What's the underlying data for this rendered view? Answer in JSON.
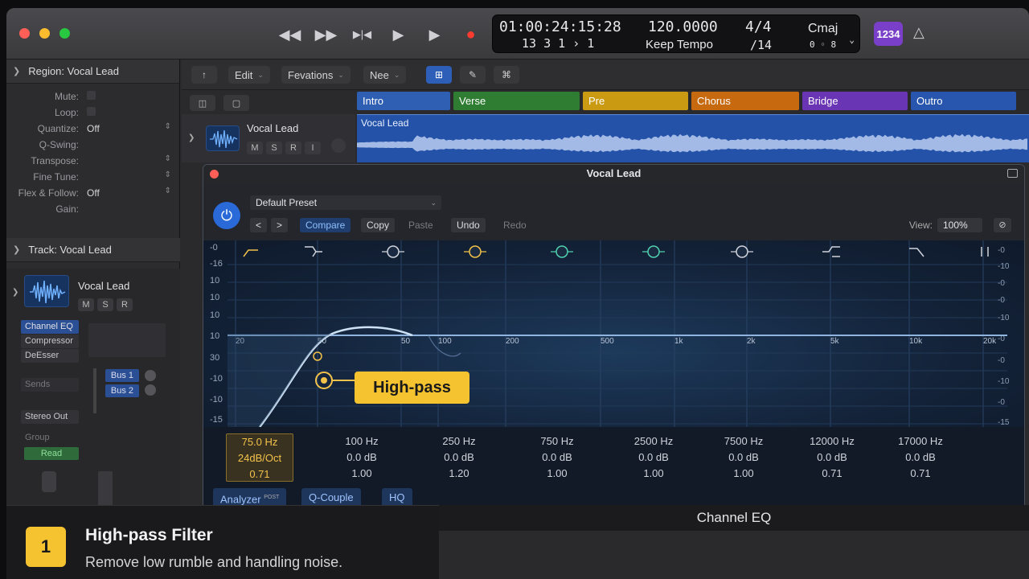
{
  "transport": {
    "rewind": "◀◀",
    "forward": "▶▶",
    "to_start": "▶|◀",
    "play": "▶",
    "play2": "▶",
    "record": "●"
  },
  "lcd": {
    "timecode": "01:00:24:15:28",
    "bars": "13  3  1   ›  1",
    "tempo": "120.0000",
    "tempo_mode": "Keep Tempo",
    "signature": "4/4",
    "division": "/14",
    "key": "Cmaj",
    "key_sub": "0 ◦ 8"
  },
  "badge": "1234",
  "inspector": {
    "region_header": "Region: Vocal Lead",
    "region_rows": [
      {
        "label": "Mute:",
        "value": "",
        "type": "check"
      },
      {
        "label": "Loop:",
        "value": "",
        "type": "check"
      },
      {
        "label": "Quantize:",
        "value": "Off",
        "type": "select"
      },
      {
        "label": "Q-Swing:",
        "value": "",
        "type": "text"
      },
      {
        "label": "Transpose:",
        "value": "",
        "type": "select"
      },
      {
        "label": "Fine Tune:",
        "value": "",
        "type": "select"
      },
      {
        "label": "Flex & Follow:",
        "value": "Off",
        "type": "select"
      },
      {
        "label": "Gain:",
        "value": "",
        "type": "text"
      }
    ],
    "track_header": "Track: Vocal Lead",
    "strip_name": "Vocal Lead",
    "strip_buttons": [
      "M",
      "S",
      "R"
    ],
    "plugins": [
      "Channel EQ",
      "Compressor",
      "DeEsser"
    ],
    "sends_label": "Sends",
    "buses": [
      "Bus 1",
      "Bus 2"
    ],
    "output": "Stereo Out",
    "group": "Group",
    "automation": "Read"
  },
  "toolbar": {
    "edit": "Edit",
    "functions": "Fevations",
    "view": "Nee"
  },
  "markers": [
    {
      "label": "Intro",
      "color": "#2f5fb3"
    },
    {
      "label": "Verse",
      "color": "#2e7d32"
    },
    {
      "label": "Pre",
      "color": "#c99a12"
    },
    {
      "label": "Chorus",
      "color": "#c7690f"
    },
    {
      "label": "Bridge",
      "color": "#6a35b5"
    },
    {
      "label": "Outro",
      "color": "#2856ae"
    }
  ],
  "track": {
    "name": "Vocal Lead",
    "buttons": [
      "M",
      "S",
      "R",
      "I"
    ],
    "region_name": "Vocal Lead"
  },
  "eq": {
    "window_title": "Vocal Lead",
    "preset": "Default Preset",
    "nav_prev": "<",
    "nav_next": ">",
    "compare": "Compare",
    "copy": "Copy",
    "paste": "Paste",
    "undo": "Undo",
    "redo": "Redo",
    "view_label": "View:",
    "view_value": "100%",
    "freq_labels": [
      "20",
      "50",
      "50",
      "100",
      "200",
      "500",
      "1k",
      "2k",
      "5k",
      "10k",
      "20k"
    ],
    "db_left": [
      "-0",
      "-16",
      "10",
      "10",
      "10",
      "10",
      "30",
      "-10",
      "-10",
      "-15"
    ],
    "db_right": [
      "-0",
      "-10",
      "-0",
      "-0",
      "-10",
      "-0",
      "-0",
      "-10",
      "-0",
      "-15"
    ],
    "bands": [
      {
        "freq": "75.0 Hz",
        "gain": "24dB/Oct",
        "q": "0.71",
        "active": true
      },
      {
        "freq": "100 Hz",
        "gain": "0.0 dB",
        "q": "1.00",
        "active": false
      },
      {
        "freq": "250 Hz",
        "gain": "0.0 dB",
        "q": "1.20",
        "active": false
      },
      {
        "freq": "750 Hz",
        "gain": "0.0 dB",
        "q": "1.00",
        "active": false
      },
      {
        "freq": "2500 Hz",
        "gain": "0.0 dB",
        "q": "1.00",
        "active": false
      },
      {
        "freq": "7500 Hz",
        "gain": "0.0 dB",
        "q": "1.00",
        "active": false
      },
      {
        "freq": "12000 Hz",
        "gain": "0.0 dB",
        "q": "0.71",
        "active": false
      },
      {
        "freq": "17000 Hz",
        "gain": "0.0 dB",
        "q": "0.71",
        "active": false
      }
    ],
    "analyzer": "Analyzer",
    "analyzer_sup": "POST",
    "qcouple": "Q-Couple",
    "hq": "HQ",
    "callout": "High-pass",
    "plugin_name": "Channel EQ"
  },
  "tip": {
    "number": "1",
    "title": "High-pass Filter",
    "description": "Remove low rumble and handling noise."
  }
}
